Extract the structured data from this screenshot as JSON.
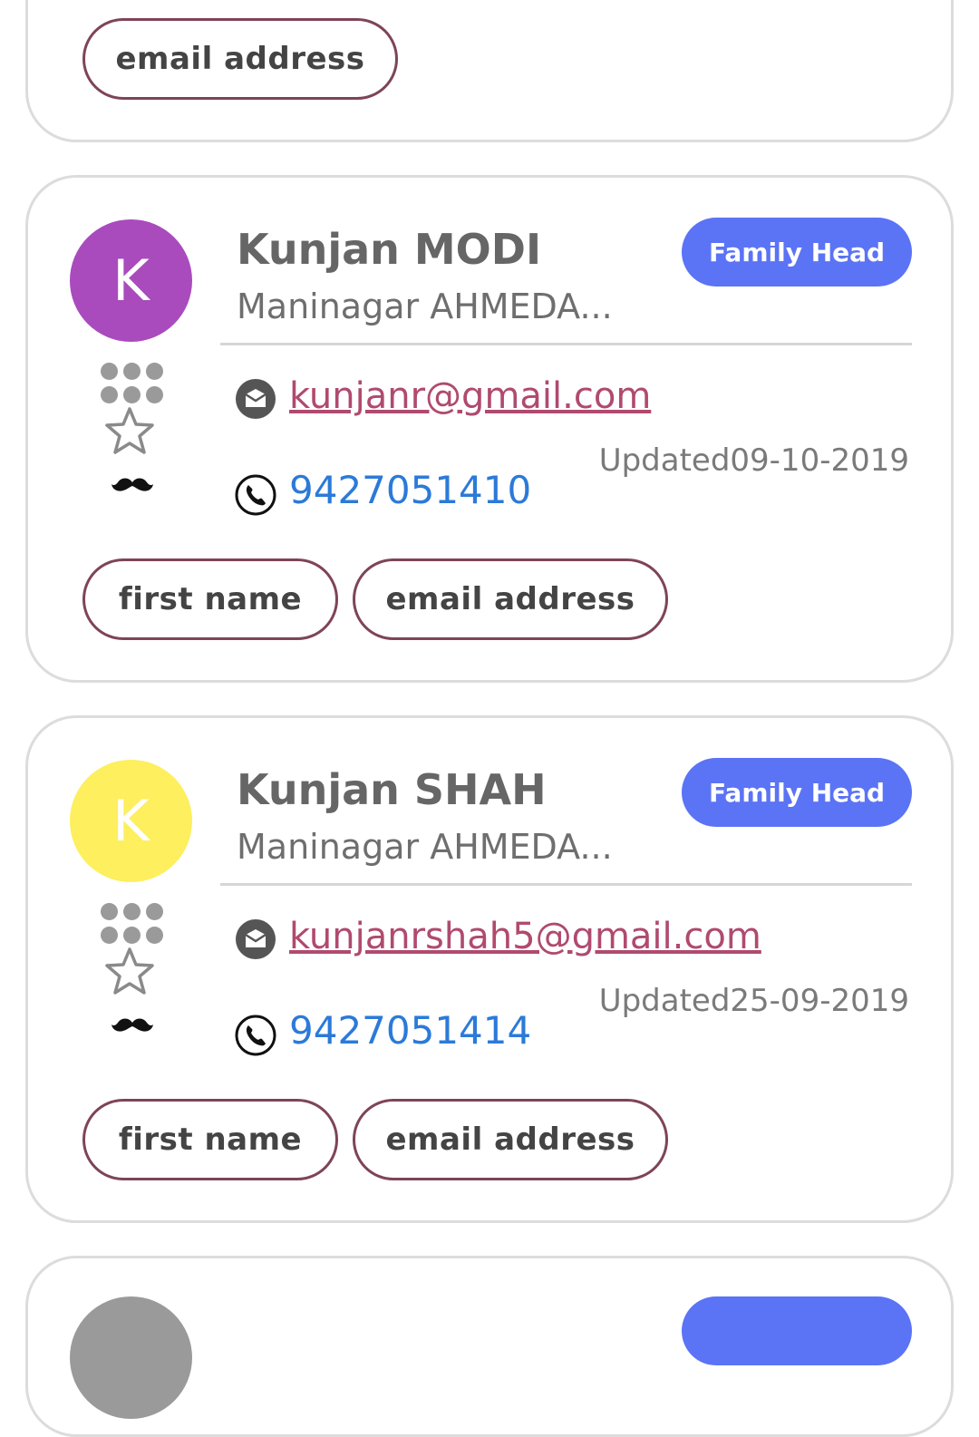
{
  "top_card": {
    "chip_email_label": "email address"
  },
  "contacts": [
    {
      "initial": "K",
      "avatar_color": "#a94bbd",
      "name": "Kunjan MODI",
      "address": "Maninagar AHMEDA...",
      "badge": "Family Head",
      "email": "kunjanr@gmail.com",
      "updated": "Updated09-10-2019",
      "phone": "9427051410",
      "chip_first_label": "first name",
      "chip_email_label": "email address"
    },
    {
      "initial": "K",
      "avatar_color": "#fdef5e",
      "name": "Kunjan SHAH",
      "address": "Maninagar AHMEDA...",
      "badge": "Family Head",
      "email": "kunjanrshah5@gmail.com",
      "updated": "Updated25-09-2019",
      "phone": "9427051414",
      "chip_first_label": "first name",
      "chip_email_label": "email address"
    }
  ],
  "colors": {
    "badge": "#5b73f5",
    "email_link": "#b04a6e",
    "phone_link": "#2b7ad9",
    "chip_border": "#7e4458"
  },
  "icons": [
    "dialpad-icon",
    "star-icon",
    "mustache-icon",
    "mail-icon",
    "phone-icon"
  ]
}
